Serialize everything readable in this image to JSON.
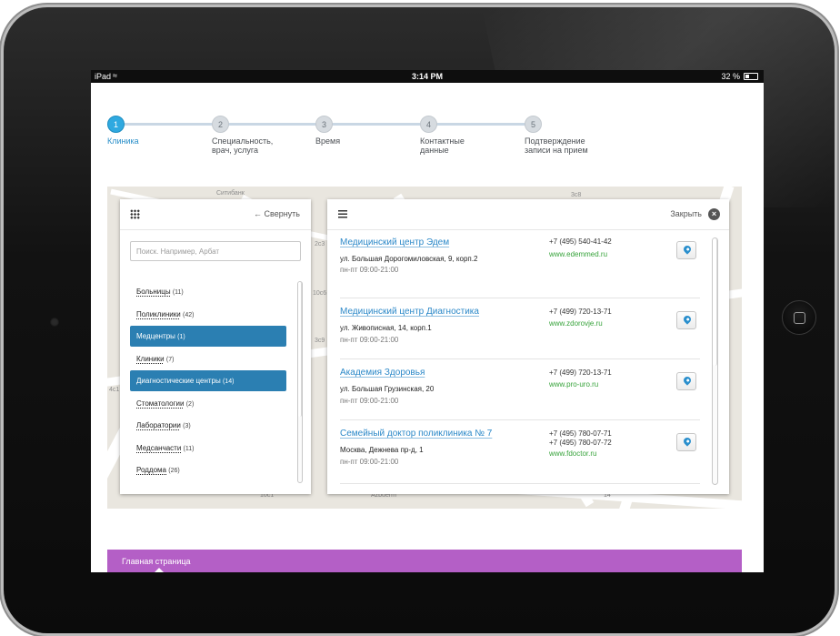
{
  "status_bar": {
    "device": "iPad",
    "time": "3:14 PM",
    "battery": "32 %"
  },
  "steps": [
    {
      "number": "1",
      "label": "Клиника",
      "active": true
    },
    {
      "number": "2",
      "label": "Специальность,\nврач, услуга",
      "active": false
    },
    {
      "number": "3",
      "label": "Время",
      "active": false
    },
    {
      "number": "4",
      "label": "Контактные\nданные",
      "active": false
    },
    {
      "number": "5",
      "label": "Подтверждение\nзаписи на прием",
      "active": false
    }
  ],
  "map_labels": [
    "Ситибанк",
    "10с1",
    "Azbuerm",
    "2с3",
    "3с8",
    "10с6",
    "3с9",
    "4с1",
    "14"
  ],
  "left_panel": {
    "collapse_label": "← Свернуть",
    "search_placeholder": "Поиск. Например, Арбат",
    "categories": [
      {
        "name": "Больницы",
        "count": "(11)",
        "selected": false
      },
      {
        "name": "Поликлиники",
        "count": "(42)",
        "selected": false
      },
      {
        "name": "Медцентры",
        "count": "(1)",
        "selected": true
      },
      {
        "name": "Клиники",
        "count": "(7)",
        "selected": false
      },
      {
        "name": "Диагностические центры",
        "count": "(14)",
        "selected": true
      },
      {
        "name": "Стоматологии",
        "count": "(2)",
        "selected": false
      },
      {
        "name": "Лаборатории",
        "count": "(3)",
        "selected": false
      },
      {
        "name": "Медсанчасти",
        "count": "(11)",
        "selected": false
      },
      {
        "name": "Роддома",
        "count": "(26)",
        "selected": false
      }
    ]
  },
  "right_panel": {
    "close_label": "Закрыть",
    "results": [
      {
        "name": "Медицинский центр Эдем",
        "address": "ул. Большая Дорогомиловская, 9, корп.2",
        "hours": "пн-пт 09:00-21:00",
        "phones": "+7 (495) 540-41-42",
        "website": "www.edemmed.ru"
      },
      {
        "name": "Медицинский центр Диагностика",
        "address": "ул. Живописная, 14, корп.1",
        "hours": "пн-пт 09:00-21:00",
        "phones": "+7 (499) 720-13-71",
        "website": "www.zdorovje.ru"
      },
      {
        "name": "Академия Здоровья",
        "address": "ул. Большая Грузинская, 20",
        "hours": "пн-пт 09:00-21:00",
        "phones": "+7 (499) 720-13-71",
        "website": "www.pro-uro.ru"
      },
      {
        "name": "Семейный доктор поликлиника № 7",
        "address": "Москва, Дежнева пр-д, 1",
        "hours": "пн-пт 09:00-21:00",
        "phones": "+7 (495) 780-07-71\n+7 (495) 780-07-72",
        "website": "www.fdoctor.ru"
      }
    ]
  },
  "footer": {
    "home_link": "Главная страница"
  },
  "colors": {
    "accent": "#2fa9e0",
    "selected": "#2b7fb2",
    "link": "#2b88c8",
    "website": "#37a33b",
    "footer": "#b45fc6"
  }
}
